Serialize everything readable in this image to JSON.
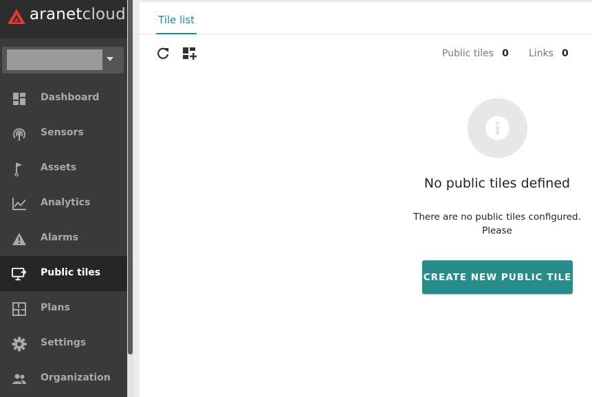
{
  "brand": {
    "name_bold": "aranet",
    "name_light": "cloud"
  },
  "org_select": {
    "value": ""
  },
  "sidebar": {
    "items": [
      {
        "label": "Dashboard",
        "icon": "dashboard-icon"
      },
      {
        "label": "Sensors",
        "icon": "sensors-icon"
      },
      {
        "label": "Assets",
        "icon": "flag-icon"
      },
      {
        "label": "Analytics",
        "icon": "chart-icon"
      },
      {
        "label": "Alarms",
        "icon": "warning-icon"
      },
      {
        "label": "Public tiles",
        "icon": "public-tiles-icon",
        "active": true
      },
      {
        "label": "Plans",
        "icon": "floor-plan-icon"
      },
      {
        "label": "Settings",
        "icon": "gear-icon"
      },
      {
        "label": "Organization",
        "icon": "people-icon"
      }
    ]
  },
  "main": {
    "tab": "Tile list",
    "stats": {
      "public_tiles_label": "Public tiles",
      "public_tiles_value": "0",
      "links_label": "Links",
      "links_value": "0"
    },
    "empty": {
      "title": "No public tiles defined",
      "text": "There are no public tiles configured. Please",
      "button": "CREATE NEW PUBLIC TILE"
    }
  },
  "colors": {
    "accent": "#268d8b",
    "sidebar_bg": "#3a3a3a",
    "sidebar_active": "#262626",
    "logo_red": "#e03a2f"
  }
}
